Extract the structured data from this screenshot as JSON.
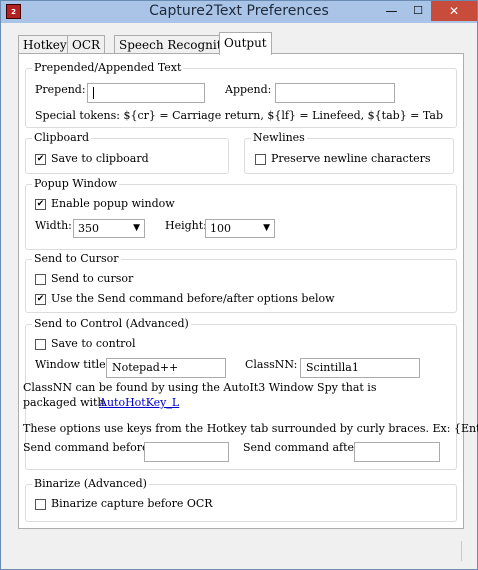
{
  "window": {
    "title": "Capture2Text Preferences",
    "app_icon_text": "2"
  },
  "titlebar_buttons": {
    "minimize": "—",
    "maximize": "☐",
    "close": "✕"
  },
  "tabs": [
    {
      "label": "Hotkeys"
    },
    {
      "label": "OCR"
    },
    {
      "label": "Speech Recognition"
    },
    {
      "label": "Output",
      "active": true
    }
  ],
  "prepended": {
    "title": "Prepended/Appended Text",
    "prepend_label": "Prepend:",
    "prepend_value": "",
    "append_label": "Append:",
    "append_value": "",
    "tokens_text": "Special tokens:  ${cr} = Carriage return,  ${lf} = Linefeed,  ${tab} = Tab"
  },
  "clipboard": {
    "title": "Clipboard",
    "save_label": "Save to clipboard",
    "save_checked": true
  },
  "newlines": {
    "title": "Newlines",
    "preserve_label": "Preserve newline characters",
    "preserve_checked": false
  },
  "popup": {
    "title": "Popup Window",
    "enable_label": "Enable popup window",
    "enable_checked": true,
    "width_label": "Width:",
    "width_value": "350",
    "height_label": "Height:",
    "height_value": "100"
  },
  "cursor": {
    "title": "Send to Cursor",
    "send_label": "Send to cursor",
    "send_checked": false,
    "use_label": "Use the Send command before/after options below",
    "use_checked": true
  },
  "control": {
    "title": "Send to Control (Advanced)",
    "save_label": "Save to control",
    "save_checked": false,
    "window_title_label": "Window title:",
    "window_title_value": "Notepad++",
    "classnn_label": "ClassNN:",
    "classnn_value": "Scintilla1",
    "info_line1": "ClassNN can be found by using the AutoIt3 Window Spy that is",
    "info_line2": "packaged with",
    "link_text": "AutoHotKey_L",
    "options_text": "These options use keys from the Hotkey tab surrounded by curly braces. Ex: {Enter}",
    "before_label": "Send command before:",
    "before_value": "",
    "after_label": "Send command after:",
    "after_value": ""
  },
  "binarize": {
    "title": "Binarize (Advanced)",
    "capture_label": "Binarize capture before OCR",
    "capture_checked": false
  },
  "check_mark": "✔"
}
